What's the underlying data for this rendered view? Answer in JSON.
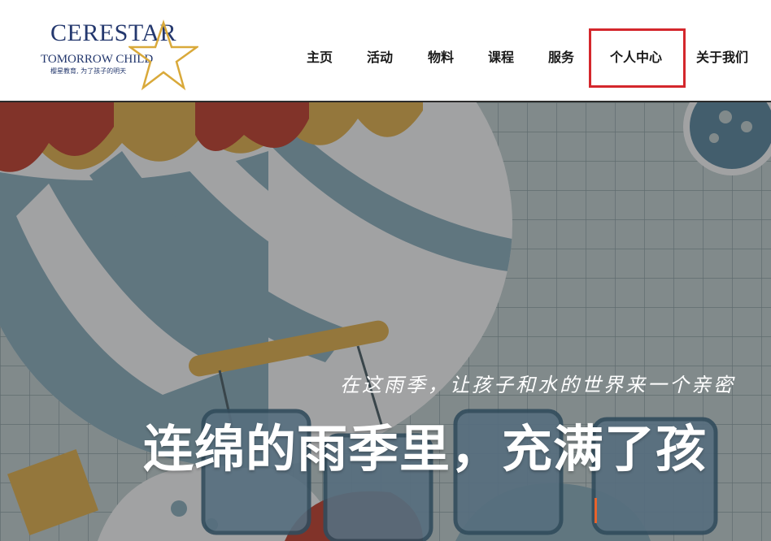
{
  "logo": {
    "wordmark_top": "CERESTAR",
    "wordmark_bottom": "TOMORROW CHILD",
    "tagline": "樱星教育, 为了孩子的明天"
  },
  "nav": {
    "items": [
      {
        "label": "主页"
      },
      {
        "label": "活动"
      },
      {
        "label": "物料"
      },
      {
        "label": "课程"
      },
      {
        "label": "服务"
      },
      {
        "label": "个人中心"
      },
      {
        "label": "关于我们"
      }
    ],
    "highlighted": "个人中心"
  },
  "hero": {
    "subtitle": "在这雨季，让孩子和水的世界来一个亲密",
    "title": "连绵的雨季里，充满了孩"
  },
  "colors": {
    "brand_navy": "#24386e",
    "star_gold": "#d9a93a",
    "highlight_red": "#d4272c",
    "accent_orange": "#e8622c"
  }
}
